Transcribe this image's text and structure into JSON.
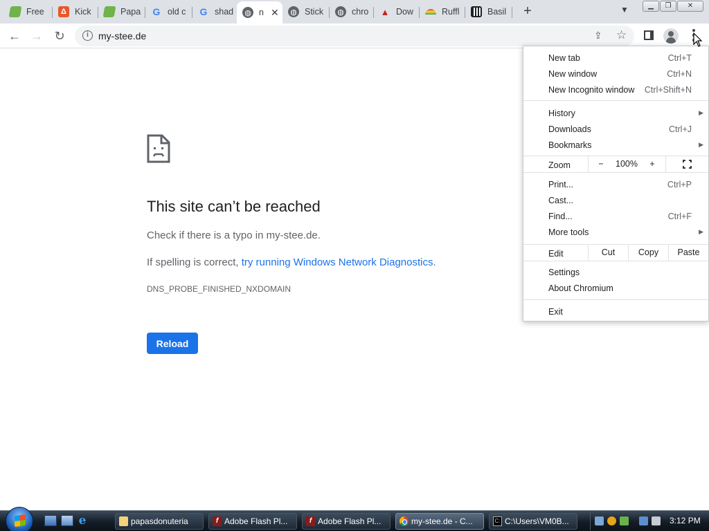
{
  "tabs": [
    {
      "title": "Free",
      "icon": "papa-icon"
    },
    {
      "title": "Kick",
      "icon": "kick-icon"
    },
    {
      "title": "Papa",
      "icon": "papa-icon"
    },
    {
      "title": "old c",
      "icon": "google-icon"
    },
    {
      "title": "shad",
      "icon": "google-icon"
    },
    {
      "title": "n",
      "icon": "globe-icon",
      "active": true
    },
    {
      "title": "Stick",
      "icon": "globe-icon"
    },
    {
      "title": "chro",
      "icon": "globe-icon"
    },
    {
      "title": "Dow",
      "icon": "car-icon"
    },
    {
      "title": "Ruffl",
      "icon": "rainbow-icon"
    },
    {
      "title": "Basil",
      "icon": "basil-icon"
    }
  ],
  "toolbar": {
    "url": "my-stee.de"
  },
  "error_page": {
    "title": "This site can’t be reached",
    "line1": "Check if there is a typo in my-stee.de.",
    "line2_prefix": "If spelling is correct, ",
    "line2_link": "try running Windows Network Diagnostics",
    "line2_suffix": ".",
    "error_code": "DNS_PROBE_FINISHED_NXDOMAIN",
    "reload_label": "Reload"
  },
  "menu": {
    "new_tab": {
      "label": "New tab",
      "shortcut": "Ctrl+T"
    },
    "new_window": {
      "label": "New window",
      "shortcut": "Ctrl+N"
    },
    "new_incognito": {
      "label": "New Incognito window",
      "shortcut": "Ctrl+Shift+N"
    },
    "history": {
      "label": "History"
    },
    "downloads": {
      "label": "Downloads",
      "shortcut": "Ctrl+J"
    },
    "bookmarks": {
      "label": "Bookmarks"
    },
    "zoom": {
      "label": "Zoom",
      "minus": "−",
      "value": "100%",
      "plus": "+"
    },
    "print": {
      "label": "Print...",
      "shortcut": "Ctrl+P"
    },
    "cast": {
      "label": "Cast..."
    },
    "find": {
      "label": "Find...",
      "shortcut": "Ctrl+F"
    },
    "more_tools": {
      "label": "More tools"
    },
    "edit": {
      "label": "Edit",
      "cut": "Cut",
      "copy": "Copy",
      "paste": "Paste"
    },
    "settings": {
      "label": "Settings"
    },
    "about": {
      "label": "About Chromium"
    },
    "exit": {
      "label": "Exit"
    }
  },
  "taskbar": {
    "items": [
      {
        "label": "papasdonuteria",
        "icon": "folder-icon"
      },
      {
        "label": "Adobe Flash Pl...",
        "icon": "flash-icon"
      },
      {
        "label": "Adobe Flash Pl...",
        "icon": "flash-icon"
      },
      {
        "label": "my-stee.de - C...",
        "icon": "chrome-icon",
        "active": true
      },
      {
        "label": "C:\\Users\\VM0B...",
        "icon": "cmd-icon"
      }
    ],
    "clock": "3:12 PM"
  }
}
